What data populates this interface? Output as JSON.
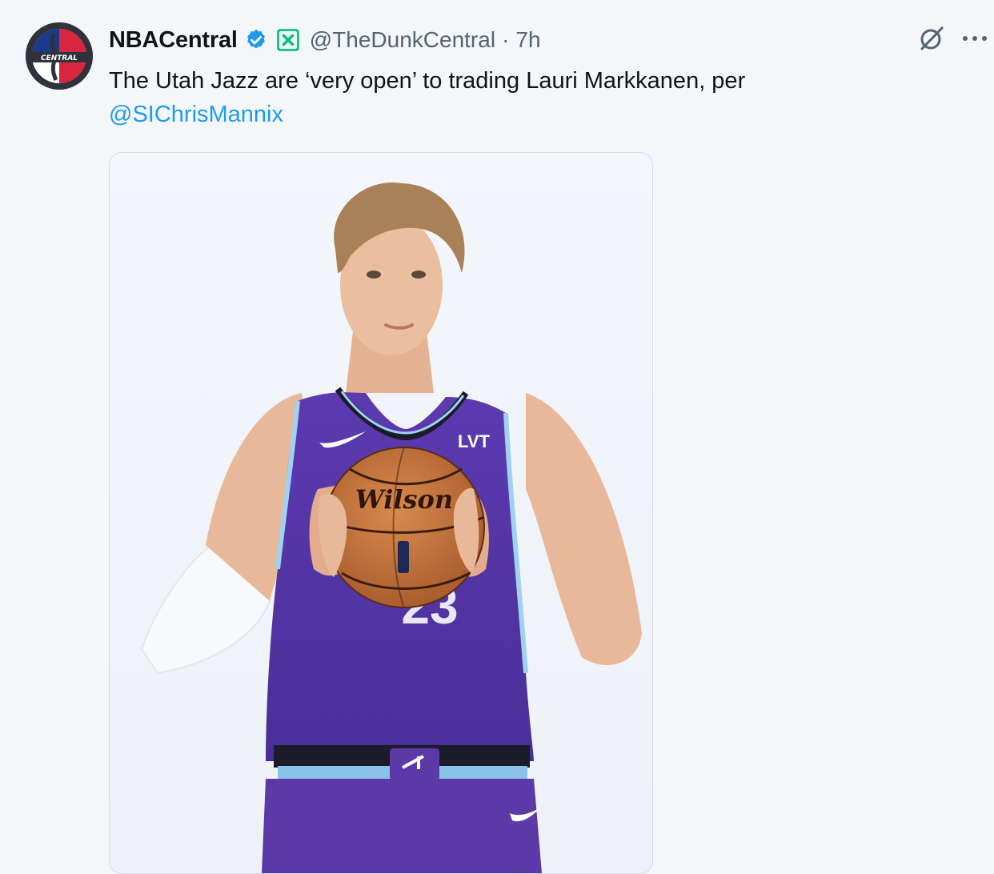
{
  "tweet": {
    "display_name": "NBACentral",
    "handle": "@TheDunkCentral",
    "separator": "·",
    "time": "7h",
    "text_main": "The Utah Jazz are ‘very open’ to trading Lauri Markkanen, per",
    "mention": "@SIChrisMannix"
  },
  "avatar": {
    "badge_text": "CENTRAL"
  },
  "media": {
    "ball_brand": "Wilson",
    "jersey_sponsor": "LVT",
    "jersey_number": "23"
  },
  "icons": {
    "verified": "verified-badge-icon",
    "affiliate": "affiliate-x-icon",
    "grok": "grok-icon",
    "more": "more-icon"
  },
  "colors": {
    "link": "#1d9bf0",
    "verified": "#1d9bf0",
    "affiliate": "#00ba7c",
    "jersey_purple": "#5b3aa8"
  }
}
